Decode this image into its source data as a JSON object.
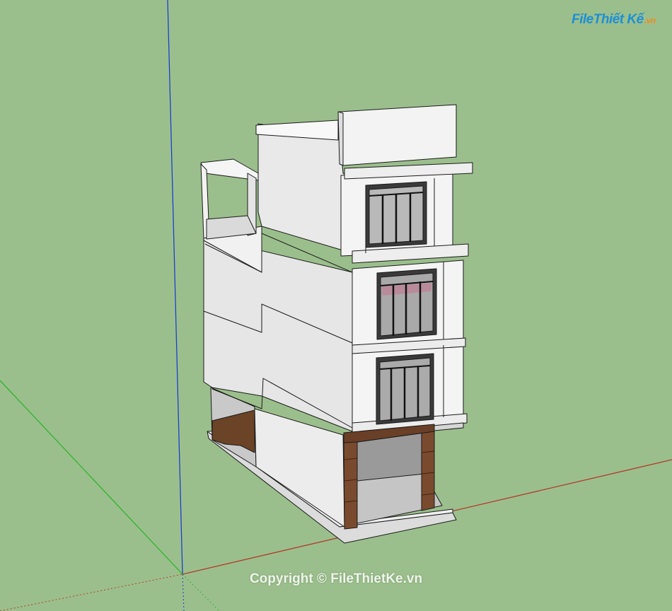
{
  "watermark": {
    "logo_part1": "File",
    "logo_part2": "Thiết Kế",
    "logo_part3": ".vn",
    "copyright": "Copyright © FileThietKe.vn"
  },
  "scene": {
    "background_color": "#9bbf8c",
    "axis_colors": {
      "blue": "#1d3fd1",
      "green": "#2fb52f",
      "red": "#b23a2a"
    },
    "model": "3-storey townhouse (SketchUp model)"
  }
}
